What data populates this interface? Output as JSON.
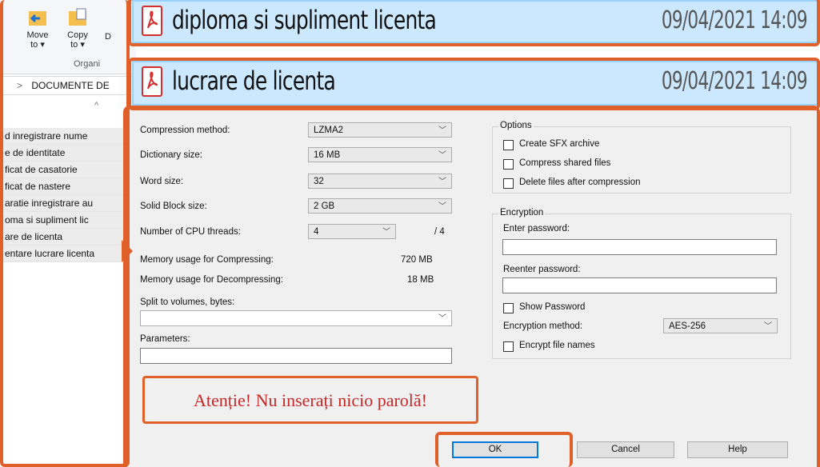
{
  "explorer": {
    "ribbon": {
      "move_to": "Move\nto ▾",
      "copy_to": "Copy\nto ▾",
      "delete_partial": "D",
      "group_label": "Organi"
    },
    "address": "DOCUMENTE DE",
    "breadcrumb_sep": ">",
    "files": [
      "d inregistrare nume",
      "e de identitate",
      "ficat de casatorie",
      "ficat de nastere",
      "aratie inregistrare au",
      "oma si supliment lic",
      "are de licenta",
      "entare lucrare licenta"
    ]
  },
  "file_list": [
    {
      "name": "diploma si supliment licenta",
      "date": "09/04/2021 14:09",
      "icon": "pdf-icon"
    },
    {
      "name": "lucrare de licenta",
      "date": "09/04/2021 14:09",
      "icon": "pdf-icon"
    }
  ],
  "dialog": {
    "compression_method": {
      "label": "Compression method:",
      "value": "LZMA2"
    },
    "dictionary_size": {
      "label": "Dictionary size:",
      "value": "16 MB"
    },
    "word_size": {
      "label": "Word size:",
      "value": "32"
    },
    "solid_block_size": {
      "label": "Solid Block size:",
      "value": "2 GB"
    },
    "cpu_threads": {
      "label": "Number of CPU threads:",
      "value": "4",
      "max": "/ 4"
    },
    "mem_compress": {
      "label": "Memory usage for Compressing:",
      "value": "720 MB"
    },
    "mem_decompress": {
      "label": "Memory usage for Decompressing:",
      "value": "18 MB"
    },
    "split_volumes": {
      "label": "Split to volumes, bytes:",
      "value": ""
    },
    "parameters": {
      "label": "Parameters:",
      "value": ""
    },
    "options": {
      "title": "Options",
      "sfx": {
        "label": "Create SFX archive",
        "checked": false
      },
      "shared": {
        "label": "Compress shared files",
        "checked": false
      },
      "delete_after": {
        "label": "Delete files after compression",
        "checked": false
      }
    },
    "encryption": {
      "title": "Encryption",
      "enter_password": {
        "label": "Enter password:",
        "value": ""
      },
      "reenter_password": {
        "label": "Reenter password:",
        "value": ""
      },
      "show_password": {
        "label": "Show Password",
        "checked": false
      },
      "method": {
        "label": "Encryption method:",
        "value": "AES-256"
      },
      "encrypt_names": {
        "label": "Encrypt file names",
        "checked": false
      }
    },
    "buttons": {
      "ok": "OK",
      "cancel": "Cancel",
      "help": "Help"
    },
    "warning": "Atenție! Nu inserați nicio parolă!"
  },
  "colors": {
    "annotation": "#e0602a",
    "selection": "#cce8ff",
    "warning_text": "#c62828"
  }
}
